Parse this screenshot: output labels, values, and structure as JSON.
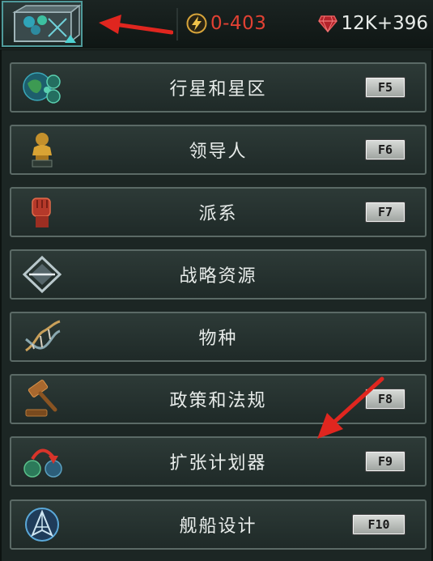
{
  "topbar": {
    "energy": {
      "icon": "lightning-icon",
      "value": "0-403",
      "color": "#e14133"
    },
    "influence": {
      "icon": "gem-icon",
      "value": "12K+396"
    }
  },
  "menu": {
    "items": [
      {
        "label": "行星和星区",
        "hotkey": "F5",
        "icon": "planets-icon"
      },
      {
        "label": "领导人",
        "hotkey": "F6",
        "icon": "leader-icon"
      },
      {
        "label": "派系",
        "hotkey": "F7",
        "icon": "fist-icon"
      },
      {
        "label": "战略资源",
        "hotkey": "",
        "icon": "diamond-icon"
      },
      {
        "label": "物种",
        "hotkey": "",
        "icon": "dna-icon"
      },
      {
        "label": "政策和法规",
        "hotkey": "F8",
        "icon": "gavel-icon"
      },
      {
        "label": "扩张计划器",
        "hotkey": "F9",
        "icon": "expansion-icon"
      },
      {
        "label": "舰船设计",
        "hotkey": "F10",
        "icon": "ship-design-icon"
      }
    ]
  },
  "colors": {
    "annotation_arrow": "#e0261f",
    "panel_border": "#5b6a66",
    "accent_teal": "#4f9a9a"
  }
}
